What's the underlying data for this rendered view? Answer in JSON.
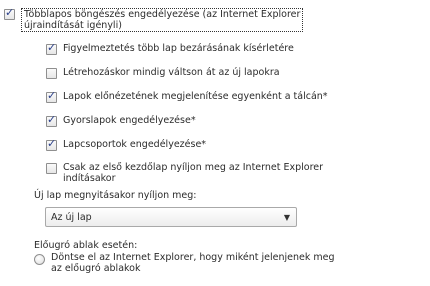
{
  "options": {
    "tabbed_browsing": {
      "label_line1": "Többlapos böngészés engedélyezése (az Internet Explorer",
      "label_line2": "újraindítását igényli)",
      "checked": true
    },
    "items": [
      {
        "label": "Figyelmeztetés több lap bezárásának kísérletére",
        "checked": true
      },
      {
        "label": "Létrehozáskor mindig váltson át az új lapokra",
        "checked": false
      },
      {
        "label": "Lapok előnézetének megjelenítése egyenként a tálcán*",
        "checked": true
      },
      {
        "label": "Gyorslapok engedélyezése*",
        "checked": true
      },
      {
        "label": "Lapcsoportok engedélyezése*",
        "checked": true
      }
    ],
    "home_tab_only": {
      "label_line1": "Csak az első kezdőlap nyíljon meg az Internet Explorer",
      "label_line2": "indításakor",
      "checked": false
    }
  },
  "new_tab": {
    "heading": "Új lap megnyitásakor nyíljon meg:",
    "selected": "Az új lap"
  },
  "popups": {
    "heading": "Előugró ablak esetén:",
    "radio_line1": "Döntse el az Internet Explorer, hogy miként jelenjenek meg",
    "radio_line2": "az előugró ablakok"
  },
  "icons": {
    "check": "checkmark-glyph",
    "dropdown": "chevron-down-icon"
  }
}
